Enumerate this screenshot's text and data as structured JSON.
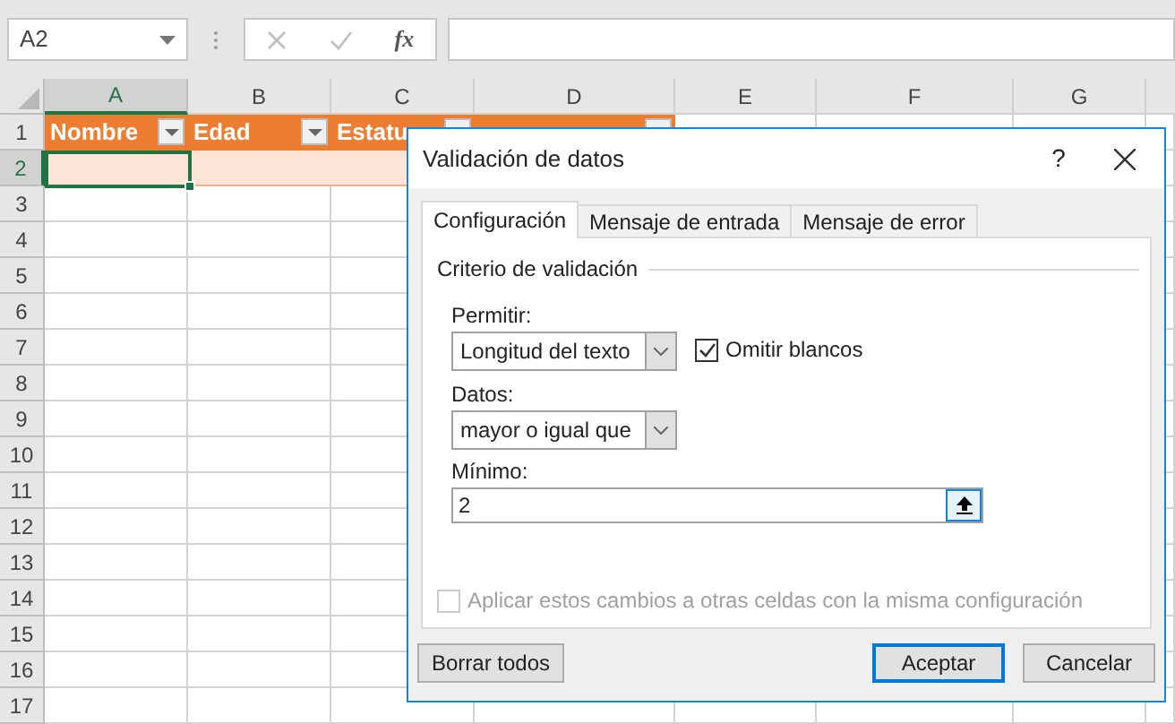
{
  "name_box": {
    "value": "A2"
  },
  "formula_bar": {
    "fx_label": "fx",
    "cancel_disabled": true,
    "enter_disabled": true
  },
  "columns": [
    {
      "label": "A",
      "selected": true
    },
    {
      "label": "B",
      "selected": false
    },
    {
      "label": "C",
      "selected": false
    },
    {
      "label": "D",
      "selected": false
    },
    {
      "label": "E",
      "selected": false
    },
    {
      "label": "F",
      "selected": false
    },
    {
      "label": "G",
      "selected": false
    }
  ],
  "rows": [
    {
      "label": "1",
      "selected": false
    },
    {
      "label": "2",
      "selected": true
    },
    {
      "label": "3",
      "selected": false
    },
    {
      "label": "4",
      "selected": false
    },
    {
      "label": "5",
      "selected": false
    },
    {
      "label": "6",
      "selected": false
    },
    {
      "label": "7",
      "selected": false
    },
    {
      "label": "8",
      "selected": false
    },
    {
      "label": "9",
      "selected": false
    },
    {
      "label": "10",
      "selected": false
    },
    {
      "label": "11",
      "selected": false
    },
    {
      "label": "12",
      "selected": false
    },
    {
      "label": "13",
      "selected": false
    },
    {
      "label": "14",
      "selected": false
    },
    {
      "label": "15",
      "selected": false
    },
    {
      "label": "16",
      "selected": false
    },
    {
      "label": "17",
      "selected": false
    }
  ],
  "table_headers": [
    "Nombre",
    "Edad",
    "Estatu"
  ],
  "dialog": {
    "title": "Validación de datos",
    "help": "?",
    "tabs": [
      {
        "label": "Configuración",
        "selected": true
      },
      {
        "label": "Mensaje de entrada",
        "selected": false
      },
      {
        "label": "Mensaje de error",
        "selected": false
      }
    ],
    "group_title": "Criterio de validación",
    "allow": {
      "label": "Permitir:",
      "value": "Longitud del texto"
    },
    "ignore_blank": {
      "label": "Omitir blancos",
      "checked": true
    },
    "data": {
      "label": "Datos:",
      "value": "mayor o igual que"
    },
    "minimum": {
      "label": "Mínimo:",
      "value": "2"
    },
    "apply_all": {
      "label": "Aplicar estos cambios a otras celdas con la misma configuración",
      "checked": false,
      "disabled": true
    },
    "buttons": [
      {
        "label": "Borrar todos",
        "default": false
      },
      {
        "label": "Aceptar",
        "default": true
      },
      {
        "label": "Cancelar",
        "default": false
      }
    ]
  }
}
